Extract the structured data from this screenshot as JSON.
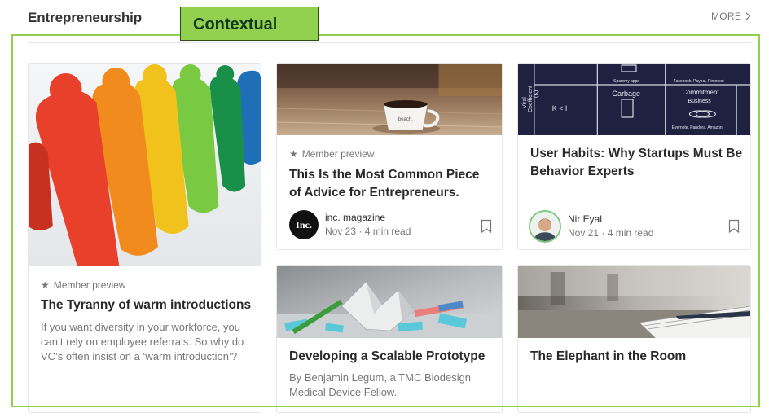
{
  "section": {
    "title": "Entrepreneurship",
    "more_label": "MORE"
  },
  "annotation": {
    "label": "Contextual",
    "color": "#92d050"
  },
  "cards": [
    {
      "preview": "Member preview",
      "title": "The Tyranny of warm introductions",
      "description": "If you want diversity in your workforce, you can’t rely on employee referrals. So why do VC’s often insist on a ‘warm introduction’?",
      "image": "colorful-wooden-figures"
    },
    {
      "preview": "Member preview",
      "title": "This Is the Most Common Piece of Advice for Entrepreneurs.",
      "author": "inc. magazine",
      "avatar_text": "Inc.",
      "date": "Nov 23",
      "read_time": "4 min read",
      "image": "coffee-cup-on-table"
    },
    {
      "title": "User Habits: Why Startups Must Be Behavior Experts",
      "author": "Nir Eyal",
      "date": "Nov 21",
      "read_time": "4 min read",
      "image": "chalkboard-diagram",
      "chalkboard": {
        "y_label_1": "Viral",
        "y_label_2": "Coefficient",
        "y_label_3": "(K)",
        "k_label": "K < I",
        "cell_1": "Spammy apps",
        "cell_2": "Facebook, Paypal, Pinterest",
        "cell_3": "Garbage",
        "cell_4": "Commitment",
        "cell_5": "Business",
        "cell_6": "Evernote, Pandora, Amazon"
      }
    },
    {
      "title": "Developing a Scalable Prototype",
      "description": "By Benjamin Legum, a TMC Biodesign Medical Device Fellow.",
      "image": "paper-crane-and-pencils"
    },
    {
      "title": "The Elephant in the Room",
      "image": "pen-on-notebook"
    }
  ]
}
